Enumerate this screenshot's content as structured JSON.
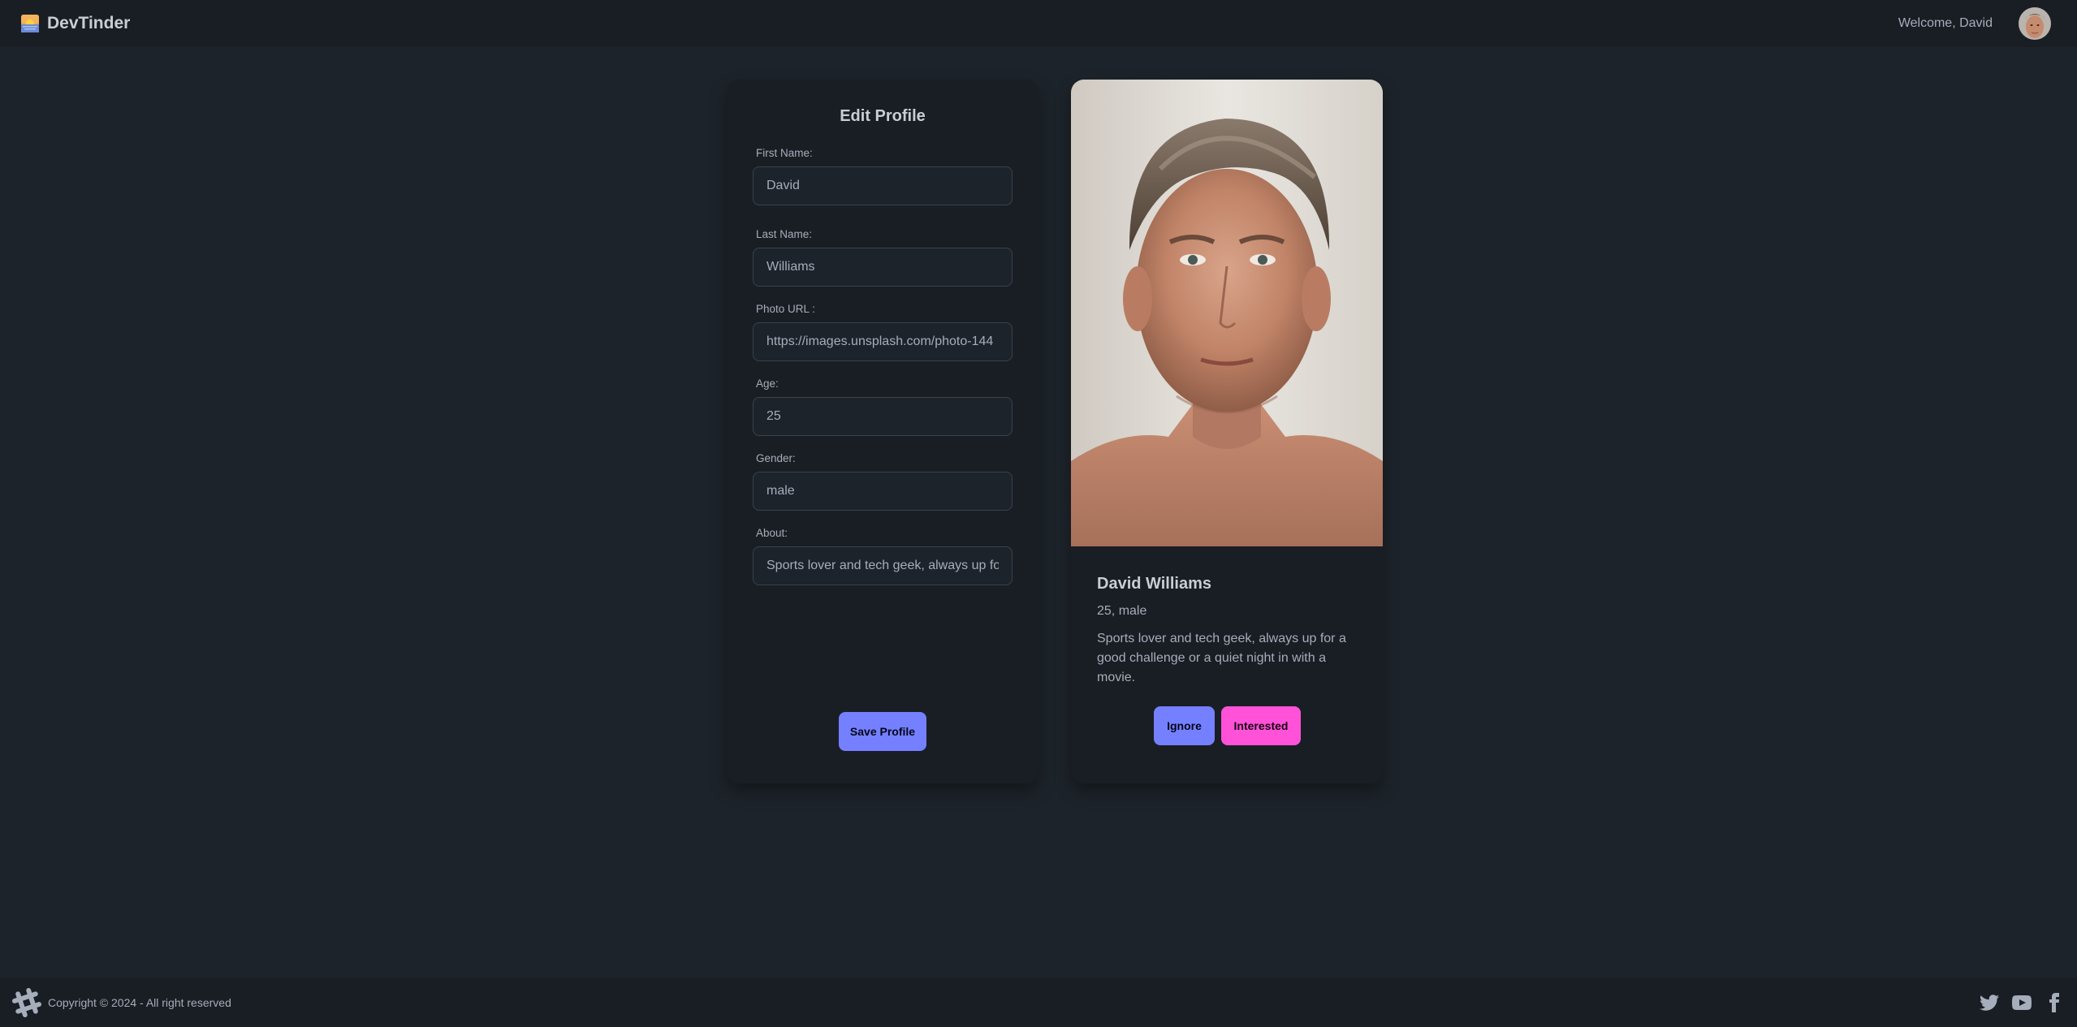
{
  "navbar": {
    "brand_emoji": "🌅",
    "brand_name": "DevTinder",
    "welcome_text": "Welcome, David"
  },
  "edit_profile": {
    "title": "Edit Profile",
    "fields": [
      {
        "label": "First Name:",
        "value": "David"
      },
      {
        "label": "Last Name:",
        "value": "Williams"
      },
      {
        "label": "Photo URL :",
        "value": "https://images.unsplash.com/photo-144"
      },
      {
        "label": "Age:",
        "value": "25"
      },
      {
        "label": "Gender:",
        "value": "male"
      },
      {
        "label": "About:",
        "value": "Sports lover and tech geek, always up for"
      }
    ],
    "save_label": "Save Profile"
  },
  "user_card": {
    "name": "David Williams",
    "meta": "25, male",
    "about": "Sports lover and tech geek, always up for a good challenge or a quiet night in with a movie.",
    "ignore_label": "Ignore",
    "interested_label": "Interested"
  },
  "footer": {
    "copyright": "Copyright © 2024 - All right reserved"
  },
  "colors": {
    "background": "#1d232a",
    "surface": "#191e24",
    "primary": "#7480ff",
    "secondary": "#ff52d9"
  },
  "icons": [
    "sunrise-icon",
    "gear-logo-icon",
    "twitter-icon",
    "youtube-icon",
    "facebook-icon"
  ]
}
